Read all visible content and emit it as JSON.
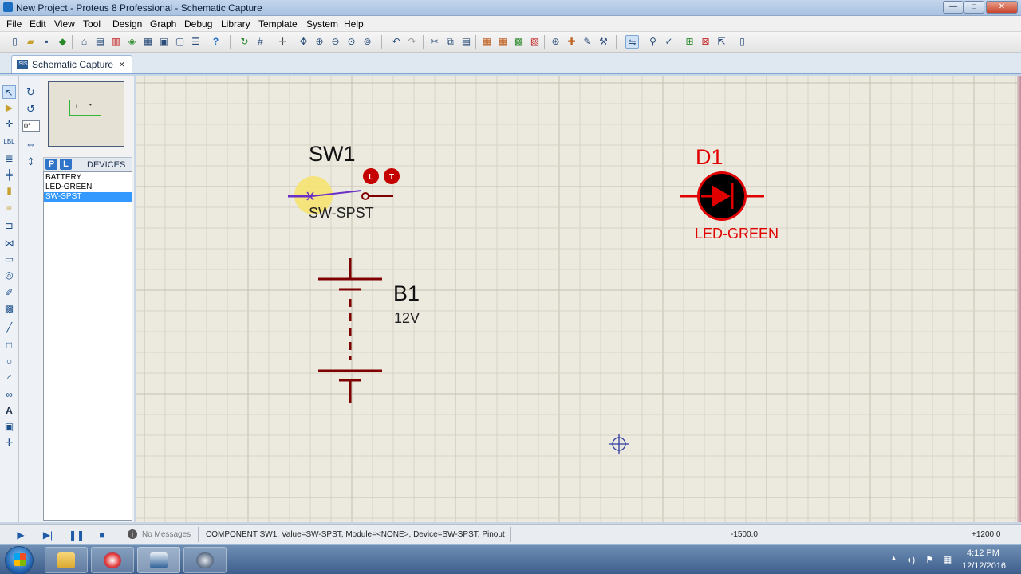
{
  "window": {
    "title": "New Project - Proteus 8 Professional - Schematic Capture",
    "minimize": "—",
    "maximize": "□",
    "close": "✕"
  },
  "menu": [
    "File",
    "Edit",
    "View",
    "Tool",
    "Design",
    "Graph",
    "Debug",
    "Library",
    "Template",
    "System",
    "Help"
  ],
  "tab": {
    "label": "Schematic Capture",
    "icon": "ISIS",
    "close": "×"
  },
  "rotation": {
    "angle": "0°"
  },
  "devices": {
    "p_label": "P",
    "l_label": "L",
    "title": "DEVICES",
    "items": [
      "BATTERY",
      "LED-GREEN",
      "SW-SPST"
    ],
    "selected": "SW-SPST"
  },
  "overview": {
    "glyph_a": "i",
    "glyph_b": "•"
  },
  "schematic": {
    "switch": {
      "ref": "SW1",
      "value": "SW-SPST",
      "badge_l": "L",
      "badge_t": "T"
    },
    "battery": {
      "ref": "B1",
      "value": "12V"
    },
    "led": {
      "ref": "D1",
      "value": "LED-GREEN"
    },
    "colors": {
      "wire": "#7f0000",
      "led": "#e00000",
      "grid_minor": "#d7d3c5",
      "grid_major": "#c3bfb0",
      "background": "#ece9df",
      "highlight": "#f7e36a",
      "selection": "#6a2fc7",
      "origin": "#2d3da0"
    }
  },
  "status": {
    "messages": "No Messages",
    "message_icon": "i",
    "text": "COMPONENT SW1, Value=SW-SPST, Module=<NONE>, Device=SW-SPST, Pinout",
    "x": "-1500.0",
    "y": "+1200.0"
  },
  "clock": {
    "time": "4:12 PM",
    "date": "12/12/2016"
  }
}
